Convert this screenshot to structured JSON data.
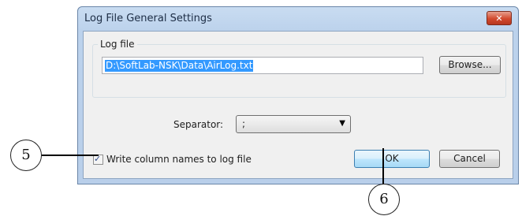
{
  "dialog": {
    "title": "Log File General Settings",
    "close_icon": "close-x-icon",
    "close_glyph": "✕"
  },
  "log_file": {
    "group_label": "Log file",
    "path_value": "D:\\SoftLab-NSK\\Data\\AirLog.txt",
    "browse_label": "Browse..."
  },
  "separator": {
    "label": "Separator:",
    "selected": ";",
    "arrow_glyph": "▼"
  },
  "write_column_names": {
    "checked": true,
    "check_glyph": "✓",
    "label": "Write column names to log file"
  },
  "buttons": {
    "ok_label": "OK",
    "cancel_label": "Cancel"
  },
  "callouts": {
    "five": "5",
    "six": "6"
  },
  "colors": {
    "title_bar": "#c9dcf1",
    "selection": "#3399ff",
    "close_button": "#d24a2e",
    "default_button_border": "#3c7fb1"
  }
}
